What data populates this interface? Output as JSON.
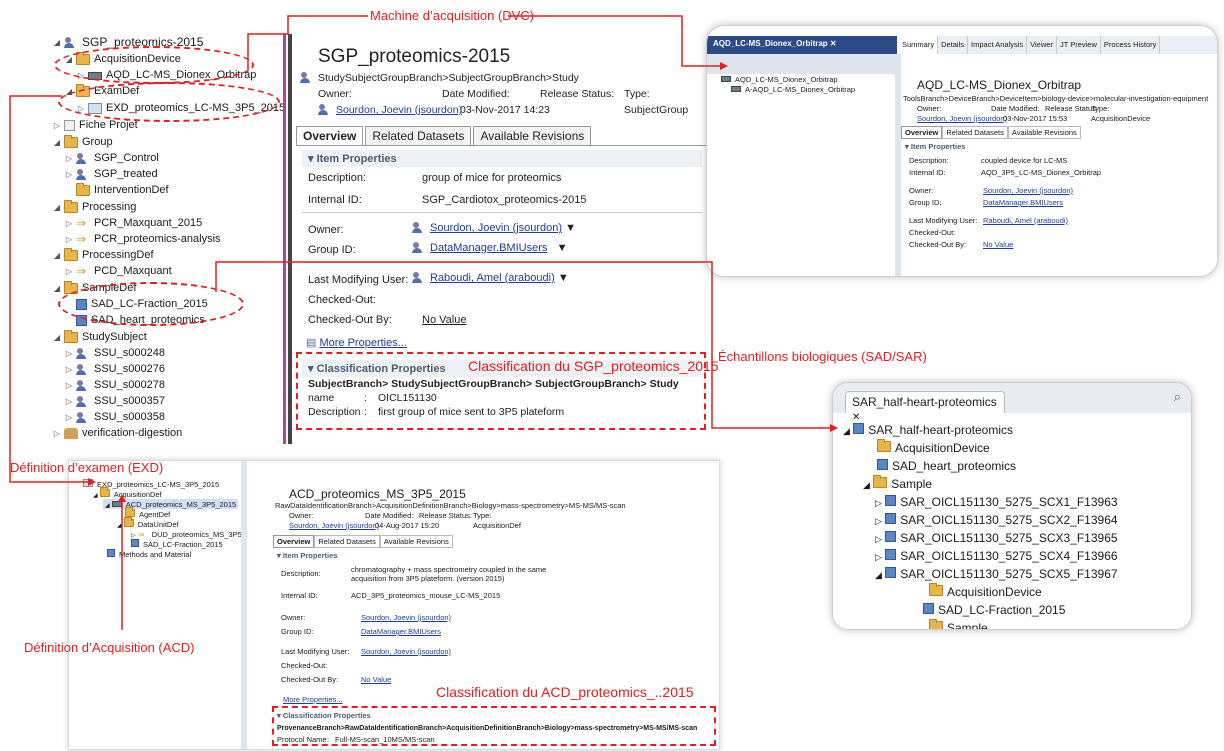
{
  "annotations": {
    "machine": "Machine d’acquisition (DVC)",
    "classif_sgp": "Classification du SGP_proteomics_2015",
    "echantillons": "Échantillons biologiques (SAD/SAR)",
    "exd": "Définition d’examen (EXD)",
    "acd": "Définition d’Acquisition (ACD)",
    "classif_acd": "Classification du ACD_proteomics_..2015"
  },
  "tree": [
    "SGP_proteomics-2015",
    "AcquisitionDevice",
    "AQD_LC-MS_Dionex_Orbitrap",
    "ExamDef",
    "EXD_proteomics_LC-MS_3P5_2015",
    "Fiche Projet",
    "Group",
    "SGP_Control",
    "SGP_treated",
    "InterventionDef",
    "Processing",
    "PCR_Maxquant_2015",
    "PCR_proteomics-analysis",
    "ProcessingDef",
    "PCD_Maxquant",
    "SampleDef",
    "SAD_LC-Fraction_2015",
    "SAD_heart_proteomics",
    "StudySubject",
    "SSU_s000248",
    "SSU_s000276",
    "SSU_s000278",
    "SSU_s000357",
    "SSU_s000358",
    "verification-digestion"
  ],
  "main": {
    "title": "SGP_proteomics-2015",
    "breadcrumb": "StudySubjectGroupBranch>SubjectGroupBranch>Study",
    "owner_label": "Owner:",
    "date_label": "Date Modified:",
    "release_label": "Release Status:",
    "type_label": "Type:",
    "owner_value": "Sourdon, Joevin (jsourdon)",
    "date_value": "03-Nov-2017 14:23",
    "type_value": "SubjectGroup",
    "tabs": [
      "Overview",
      "Related Datasets",
      "Available Revisions"
    ],
    "item_properties": "Item Properties",
    "props": {
      "description_label": "Description:",
      "description_value": "group of mice for proteomics",
      "internal_id_label": "Internal ID:",
      "internal_id_value": "SGP_Cardiotox_proteomics-2015",
      "owner_label": "Owner:",
      "owner_value": "Sourdon, Joevin (jsourdon)",
      "group_label": "Group ID:",
      "group_value": "DataManager.BMIUsers",
      "lmu_label": "Last Modifying User:",
      "lmu_value": "Raboudi, Amel (araboudi)",
      "checked_out_label": "Checked-Out:",
      "checked_out_by_label": "Checked-Out By:",
      "checked_out_by_value": "No Value"
    },
    "more_properties": "More Properties...",
    "classification": {
      "header": "Classification Properties",
      "path": "SubjectBranch> StudySubjectGroupBranch> SubjectGroupBranch> Study",
      "name_label": "name",
      "name_value": "OICL151130",
      "desc_label": "Description",
      "desc_value": "first group of mice sent to 3P5 plateform"
    }
  },
  "top_right": {
    "left_tab": "AQD_LC-MS_Dionex_Orbitrap",
    "tree": [
      "AQD_LC-MS_Dionex_Orbitrap",
      "A-AQD_LC-MS_Dionex_Orbitrap"
    ],
    "tabs": [
      "Summary",
      "Details",
      "Impact Analysis",
      "Viewer",
      "JT Preview",
      "Process History"
    ],
    "title": "AQD_LC-MS_Dionex_Orbitrap",
    "breadcrumb": "ToolsBranch>DeviceBranch>DeviceItem>biology-device>molecular-investigation-equipment",
    "owner_label": "Owner:",
    "date_label": "Date Modified:",
    "release_label": "Release Status:",
    "type_label": "Type:",
    "owner_value": "Sourdon, Joevin (jsourdon)",
    "date_value": "03-Nov-2017 15:53",
    "type_value": "AcquisitionDevice",
    "subtabs": [
      "Overview",
      "Related Datasets",
      "Available Revisions"
    ],
    "item_properties": "Item Properties",
    "description_label": "Description:",
    "description_value": "coupled device for LC-MS",
    "internal_id_label": "Internal ID:",
    "internal_id_value": "AQD_3P5_LC-MS_Dionex_Orbitrap",
    "owner2_label": "Owner:",
    "owner2_value": "Sourdon, Joevin (jsourdon)",
    "group_label": "Group ID:",
    "group_value": "DataManager.BMIUsers",
    "lmu_label": "Last Modifying User:",
    "lmu_value": "Raboudi, Amel (araboudi)",
    "checked_out_label": "Checked-Out:",
    "checked_out_by_label": "Checked-Out By:",
    "checked_out_by_value": "No Value"
  },
  "bottom_left": {
    "tree": [
      "EXD_proteomics_LC-MS_3P5_2015",
      "AcquisitionDef",
      "ACD_proteomics_MS_3P5_2015",
      "AgentDef",
      "DataUnitDef",
      "DUD_proteomics_MS_3P5",
      "SAD_LC-Fraction_2015",
      "Methods and Material"
    ],
    "title": "ACD_proteomics_MS_3P5_2015",
    "breadcrumb": "RawDataIdentificationBranch>AcquisitionDefinitionBranch>Biology>mass-spectrometry>MS-MS/MS-scan",
    "owner_label": "Owner:",
    "date_label": "Date Modified:",
    "release_label": "Release Status:",
    "type_label": "Type:",
    "owner_value": "Sourdon, Joevin (jsourdon)",
    "date_value": "04-Aug-2017 15:20",
    "type_value": "AcquisitionDef",
    "tabs": [
      "Overview",
      "Related Datasets",
      "Available Revisions"
    ],
    "item_properties": "Item Properties",
    "description_label": "Description:",
    "description_value_1": "chromatography + mass spectrometry coupled in the same",
    "description_value_2": "acquisition from 3P5 plateform. (version 2015)",
    "internal_id_label": "Internal ID:",
    "internal_id_value": "ACD_3P5_proteomics_mouse_LC-MS_2015",
    "owner2_label": "Owner:",
    "owner2_value": "Sourdon, Joevin (jsourdon)",
    "group_label": "Group ID:",
    "group_value": "DataManager.BMIUsers",
    "lmu_label": "Last Modifying User:",
    "lmu_value": "Sourdon, Joevin (jsourdon)",
    "checked_out_label": "Checked-Out:",
    "checked_out_by_label": "Checked-Out By:",
    "checked_out_by_value": "No Value",
    "more_properties": "More Properties...",
    "classification_header": "Classification Properties",
    "classification_path": "ProvenanceBranch>RawDataIdentificationBranch>AcquisitionDefinitionBranch>Biology>mass-spectrometry>MS-MS/MS-scan",
    "protocol_label": "Protocol Name",
    "protocol_value": "Full-MS-scan_10MS/MS-scan"
  },
  "sar": {
    "tab": "SAR_half-heart-proteomics",
    "tree": [
      "SAR_half-heart-proteomics",
      "AcquisitionDevice",
      "SAD_heart_proteomics",
      "Sample",
      "SAR_OICL151130_5275_SCX1_F13963",
      "SAR_OICL151130_5275_SCX2_F13964",
      "SAR_OICL151130_5275_SCX3_F13965",
      "SAR_OICL151130_5275_SCX4_F13966",
      "SAR_OICL151130_5275_SCX5_F13967",
      "AcquisitionDevice",
      "SAD_LC-Fraction_2015",
      "Sample"
    ]
  },
  "colors": {
    "annotation_red": "#e41e1e",
    "accent_bar": "#b040a8",
    "link_blue": "#1c3d9c"
  }
}
